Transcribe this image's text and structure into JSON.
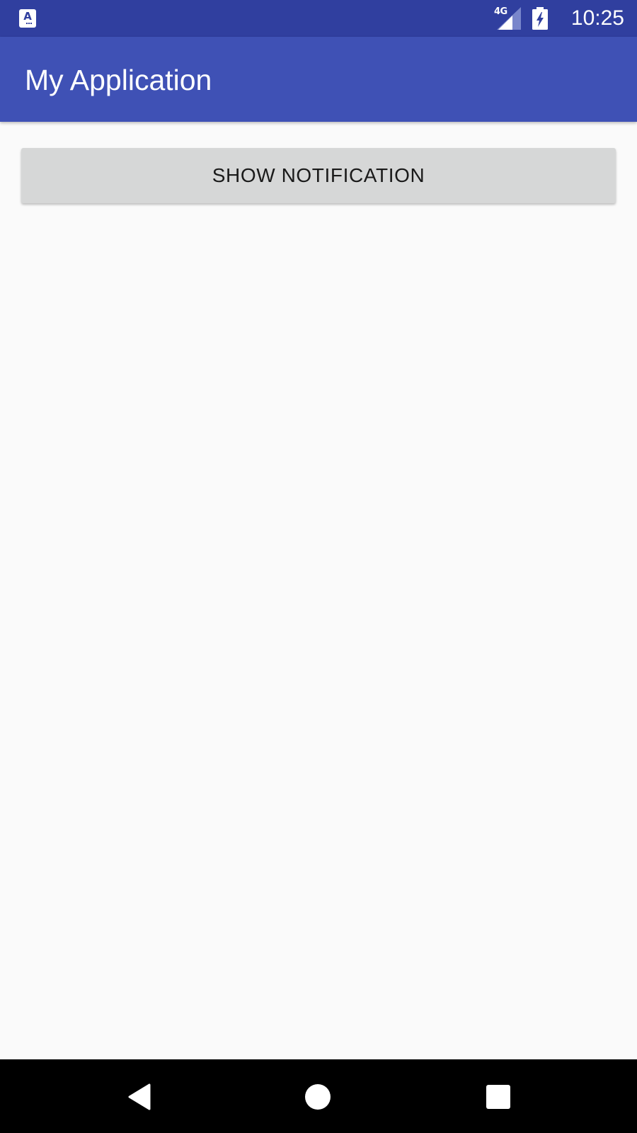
{
  "status_bar": {
    "app_icon": "font-accessibility-icon",
    "network_type": "4G",
    "signal_icon": "cellular-signal-icon",
    "battery_icon": "battery-charging-icon",
    "time": "10:25"
  },
  "app_bar": {
    "title": "My Application"
  },
  "main": {
    "show_notification_label": "SHOW NOTIFICATION"
  },
  "nav_bar": {
    "back_icon": "back-triangle-icon",
    "home_icon": "home-circle-icon",
    "recents_icon": "recents-square-icon"
  },
  "colors": {
    "status_bar": "#303f9f",
    "app_bar": "#3f51b5",
    "background": "#fafafa",
    "button": "#d6d7d7",
    "nav_bar": "#000000"
  }
}
